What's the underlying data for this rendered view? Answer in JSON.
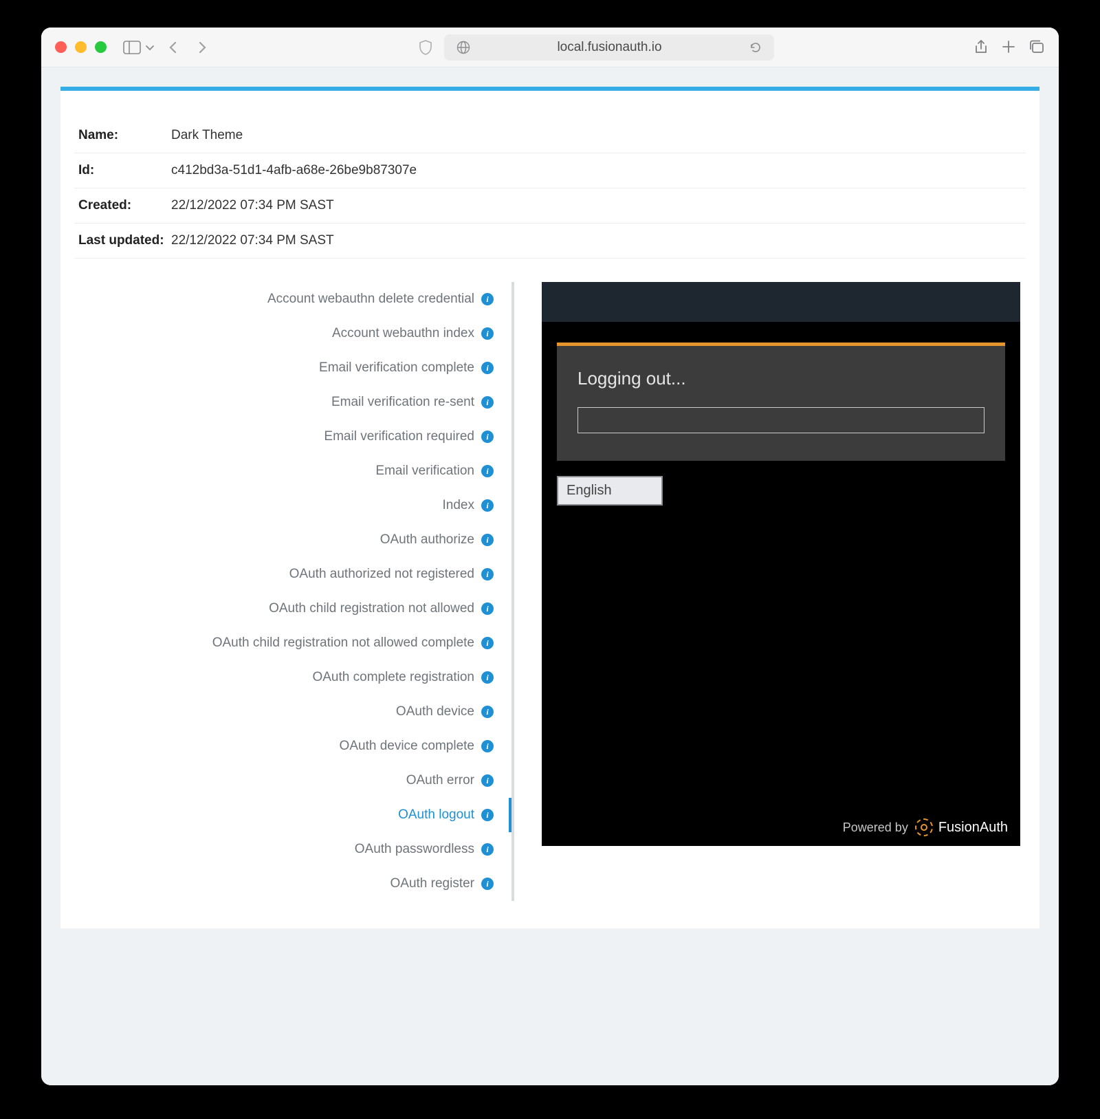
{
  "browser": {
    "url_display": "local.fusionauth.io"
  },
  "meta": {
    "labels": {
      "name": "Name:",
      "id": "Id:",
      "created": "Created:",
      "updated": "Last updated:"
    },
    "name": "Dark Theme",
    "id": "c412bd3a-51d1-4afb-a68e-26be9b87307e",
    "created": "22/12/2022 07:34 PM SAST",
    "updated": "22/12/2022 07:34 PM SAST"
  },
  "templates": [
    {
      "label": "Account webauthn delete credential",
      "active": false
    },
    {
      "label": "Account webauthn index",
      "active": false
    },
    {
      "label": "Email verification complete",
      "active": false
    },
    {
      "label": "Email verification re-sent",
      "active": false
    },
    {
      "label": "Email verification required",
      "active": false
    },
    {
      "label": "Email verification",
      "active": false
    },
    {
      "label": "Index",
      "active": false
    },
    {
      "label": "OAuth authorize",
      "active": false
    },
    {
      "label": "OAuth authorized not registered",
      "active": false
    },
    {
      "label": "OAuth child registration not allowed",
      "active": false
    },
    {
      "label": "OAuth child registration not allowed complete",
      "active": false
    },
    {
      "label": "OAuth complete registration",
      "active": false
    },
    {
      "label": "OAuth device",
      "active": false
    },
    {
      "label": "OAuth device complete",
      "active": false
    },
    {
      "label": "OAuth error",
      "active": false
    },
    {
      "label": "OAuth logout",
      "active": true
    },
    {
      "label": "OAuth passwordless",
      "active": false
    },
    {
      "label": "OAuth register",
      "active": false
    }
  ],
  "preview": {
    "heading": "Logging out...",
    "language": "English",
    "powered_by": "Powered by",
    "brand": "FusionAuth"
  }
}
